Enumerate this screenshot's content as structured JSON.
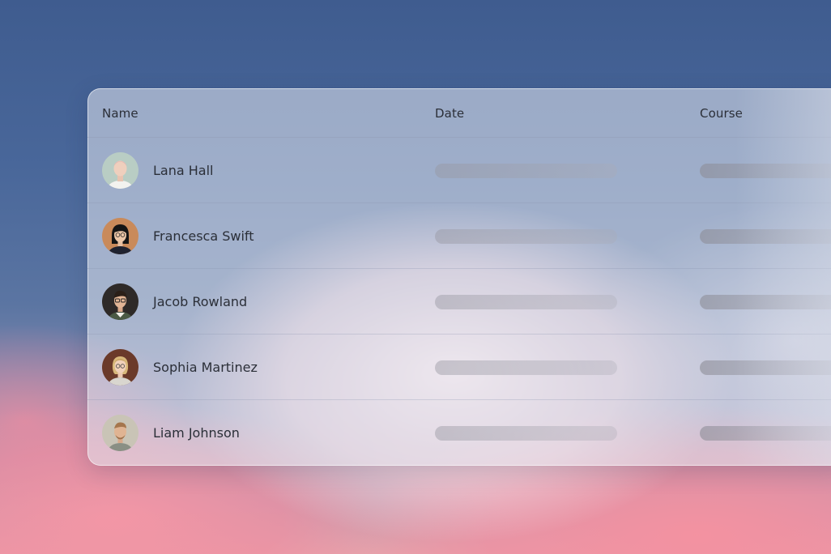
{
  "table": {
    "columns": {
      "name": "Name",
      "date": "Date",
      "course": "Course"
    },
    "rows": [
      {
        "name": "Lana Hall",
        "avatar": "avatar-lana-hall"
      },
      {
        "name": "Francesca Swift",
        "avatar": "avatar-francesca-swift"
      },
      {
        "name": "Jacob Rowland",
        "avatar": "avatar-jacob-rowland"
      },
      {
        "name": "Sophia Martinez",
        "avatar": "avatar-sophia-martinez"
      },
      {
        "name": "Liam Johnson",
        "avatar": "avatar-liam-johnson"
      }
    ]
  },
  "colors": {
    "sky_top": "#3f5c8f",
    "cloud_pink": "#f09aa8",
    "text_primary": "#2b2f38",
    "placeholder_bar": "#a0a0aa"
  }
}
